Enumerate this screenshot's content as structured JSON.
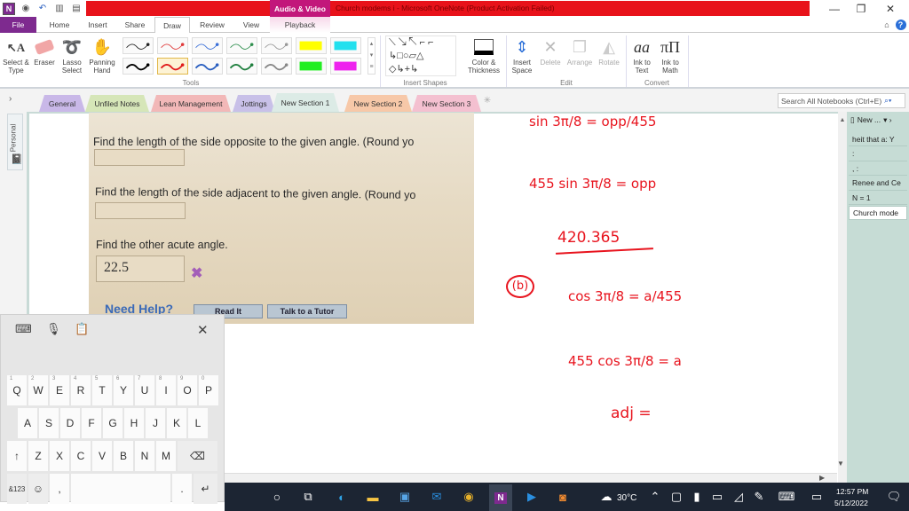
{
  "titlebar": {
    "contextual_tab_group": "Audio & Video",
    "window_title": "Church modems i - Microsoft OneNote (Product Activation Failed)",
    "controls": {
      "minimize": "—",
      "restore": "❐",
      "close": "✕"
    }
  },
  "ribbon_tabs": [
    "File",
    "Home",
    "Insert",
    "Share",
    "Draw",
    "Review",
    "View",
    "Playback"
  ],
  "active_tab": "Draw",
  "ribbon": {
    "tools": [
      {
        "label": "Select & Type",
        "icon": "select-type-icon"
      },
      {
        "label": "Eraser",
        "icon": "eraser-icon"
      },
      {
        "label": "Lasso Select",
        "icon": "lasso-icon"
      },
      {
        "label": "Panning Hand",
        "icon": "hand-icon"
      }
    ],
    "pens_row1": [
      "#222222",
      "#e03a3a",
      "#3a6fd8",
      "#2f8f4e",
      "#999999",
      "#ffff00",
      "#22e0ee"
    ],
    "pens_row2": [
      "#000000",
      "#e01a1a",
      "#2a5fc0",
      "#1f7f3e",
      "#888888",
      "#22ee22",
      "#ee22ee"
    ],
    "tools_group": "Tools",
    "shapes_group": "Insert Shapes",
    "color_thickness": "Color & Thickness",
    "edit": [
      {
        "label": "Insert Space",
        "enabled": true
      },
      {
        "label": "Delete",
        "enabled": false
      },
      {
        "label": "Arrange",
        "enabled": false
      },
      {
        "label": "Rotate",
        "enabled": false
      }
    ],
    "edit_group": "Edit",
    "convert": [
      {
        "label": "Ink to Text",
        "glyph": "aa"
      },
      {
        "label": "Ink to Math",
        "glyph": "πΠ"
      }
    ],
    "convert_group": "Convert"
  },
  "section_tabs": [
    {
      "label": "General",
      "color": "#c9b8e8"
    },
    {
      "label": "Unfiled Notes",
      "color": "#d6e6b8"
    },
    {
      "label": "Lean Management",
      "color": "#f2b8b8"
    },
    {
      "label": "Jottings",
      "color": "#c8c0e8"
    },
    {
      "label": "New Section 1",
      "color": "#dcebe6"
    },
    {
      "label": "New Section 2",
      "color": "#f7c8a8"
    },
    {
      "label": "New Section 3",
      "color": "#f4c0d0"
    }
  ],
  "active_section": "New Section 1",
  "search": {
    "placeholder": "Search All Notebooks (Ctrl+E)"
  },
  "notebook": {
    "name": "Personal"
  },
  "page_list": {
    "new_page": "New ...",
    "pages": [
      "heit that a: Y",
      ":",
      ", :",
      "Renee and Ce",
      "N = 1",
      "Church mode"
    ],
    "active_page": "Church mode"
  },
  "problem_photo": {
    "q1": "Find the length of the side opposite to the given angle. (Round yo",
    "q2": "Find the length of the side adjacent to the given angle. (Round yo",
    "q3": "Find the other acute angle.",
    "q3_answer": "22.5",
    "need_help": "Need Help?",
    "read_it": "Read It",
    "talk_tutor": "Talk to a Tutor"
  },
  "handwriting": {
    "line1": "sin 3π/8 = opp/455",
    "line2": "455 sin 3π/8 = opp",
    "line3": "420.365",
    "part_label": "(b)",
    "line4": "cos 3π/8 = a/455",
    "line5": "455 cos 3π/8 = a",
    "line6": "adj ="
  },
  "keyboard": {
    "row1": [
      [
        "Q",
        "1"
      ],
      [
        "W",
        "2"
      ],
      [
        "E",
        "3"
      ],
      [
        "R",
        "4"
      ],
      [
        "T",
        "5"
      ],
      [
        "Y",
        "6"
      ],
      [
        "U",
        "7"
      ],
      [
        "I",
        "8"
      ],
      [
        "O",
        "9"
      ],
      [
        "P",
        "0"
      ]
    ],
    "row2": [
      "A",
      "S",
      "D",
      "F",
      "G",
      "H",
      "J",
      "K",
      "L"
    ],
    "row3": [
      "Z",
      "X",
      "C",
      "V",
      "B",
      "N",
      "M"
    ],
    "shift": "↑",
    "backspace": "⌫",
    "symbols": "&123",
    "emoji": "☺",
    "comma": ",",
    "period": ".",
    "enter": "↵",
    "close": "✕"
  },
  "taskbar": {
    "weather": "30°C",
    "time": "12:57 PM",
    "date": "5/12/2022"
  }
}
